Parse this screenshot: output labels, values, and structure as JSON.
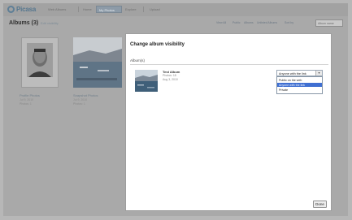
{
  "app": {
    "logo": "Picasa",
    "logo_suffix": "Web Albums"
  },
  "topbar": {
    "tabs": [
      {
        "label": "Home"
      },
      {
        "label": "My Photos"
      },
      {
        "label": "Explore"
      }
    ],
    "upload_label": "Upload"
  },
  "subbar": {
    "albums_title": "Albums (3)",
    "albums_link": "Edit visibility",
    "links": [
      "View All",
      "Public",
      "Albums",
      "Unlisted Albums",
      "Sort by",
      "Album name"
    ]
  },
  "albums": [
    {
      "name": "Profile Photos",
      "meta": [
        "Jul 9, 2010",
        "Photos: 1"
      ]
    },
    {
      "name": "Snapshot Photos",
      "meta": [
        "Jul 9, 2010",
        "Photos: 1"
      ]
    }
  ],
  "dialog": {
    "title": "Change album visibility",
    "section": "Album(s)",
    "album": {
      "name": "Test Album",
      "meta": [
        "Photos: 18",
        "Aug 3, 2010"
      ]
    },
    "select_value": "Anyone with the link",
    "options": [
      "Public on the web",
      "Anyone with the link",
      "Private"
    ],
    "selected_index": 1,
    "done_label": "Done"
  }
}
